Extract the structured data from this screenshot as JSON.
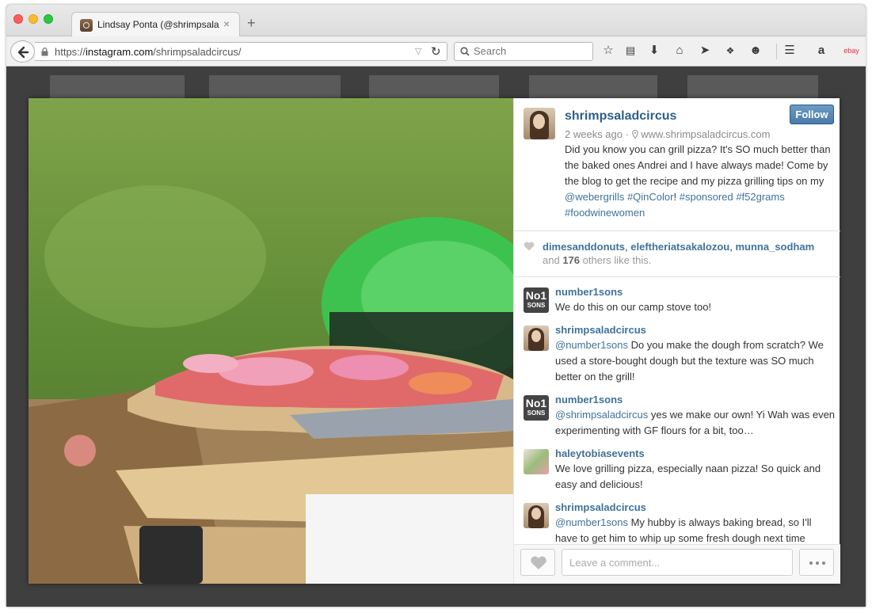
{
  "browser": {
    "tab_title": "Lindsay Ponta (@shrimpsala…",
    "new_tab_symbol": "+",
    "close_symbol": "×",
    "url_prefix": "https://",
    "url_host": "instagram.com",
    "url_path": "/shrimpsaladcircus/",
    "search_placeholder": "Search",
    "toolbar_icons": [
      "bookmark-star-icon",
      "reading-list-icon",
      "downloads-icon",
      "home-icon",
      "send-icon",
      "extension-icon",
      "emoji-icon",
      "menu-icon",
      "amazon-icon",
      "ebay-icon"
    ],
    "amazon_glyph": "a",
    "ebay_glyph": "ebay"
  },
  "post": {
    "username": "shrimpsaladcircus",
    "follow_label": "Follow",
    "time_ago": "2 weeks ago",
    "meta_separator": "·",
    "website": "www.shrimpsaladcircus.com",
    "caption_text": "Did you know you can grill pizza? It's SO much better than the baked ones Andrei and I have always made! Come by the blog to get the recipe and my pizza grilling tips on my ",
    "caption_links": [
      "@webergrills",
      "#QinColor",
      "#sponsored",
      "#f52grams",
      "#foodwinewomen"
    ],
    "caption_exclaim": "!",
    "likers": [
      "dimesanddonuts",
      "eleftheriatsakalozou",
      "munna_sodham"
    ],
    "likes_prefix": "and",
    "likes_count": "176",
    "likes_suffix": "others like this."
  },
  "comments": [
    {
      "user": "number1sons",
      "avatar": "sons",
      "mention": "",
      "text": "We do this on our camp stove too!"
    },
    {
      "user": "shrimpsaladcircus",
      "avatar": "person",
      "mention": "@number1sons",
      "text": " Do you make the dough from scratch? We used a store-bought dough but the texture was SO much better on the grill!"
    },
    {
      "user": "number1sons",
      "avatar": "sons",
      "mention": "@shrimpsaladcircus",
      "text": " yes we make our own! Yi Wah was even experimenting with GF flours for a bit, too…"
    },
    {
      "user": "haleytobiasevents",
      "avatar": "flower",
      "mention": "",
      "text": "We love grilling pizza, especially naan pizza! So quick and easy and delicious!"
    },
    {
      "user": "shrimpsaladcircus",
      "avatar": "person",
      "mention": "@number1sons",
      "text": " My hubby is always baking bread, so I'll have to get him to whip up some fresh dough next time"
    }
  ],
  "avatar_text": {
    "sons_top": "No1",
    "sons_bottom": "SONS"
  },
  "footer": {
    "comment_placeholder": "Leave a comment..."
  },
  "colors": {
    "link": "#3f729b",
    "username": "#2e5e86",
    "follow": "#4b7bab"
  }
}
